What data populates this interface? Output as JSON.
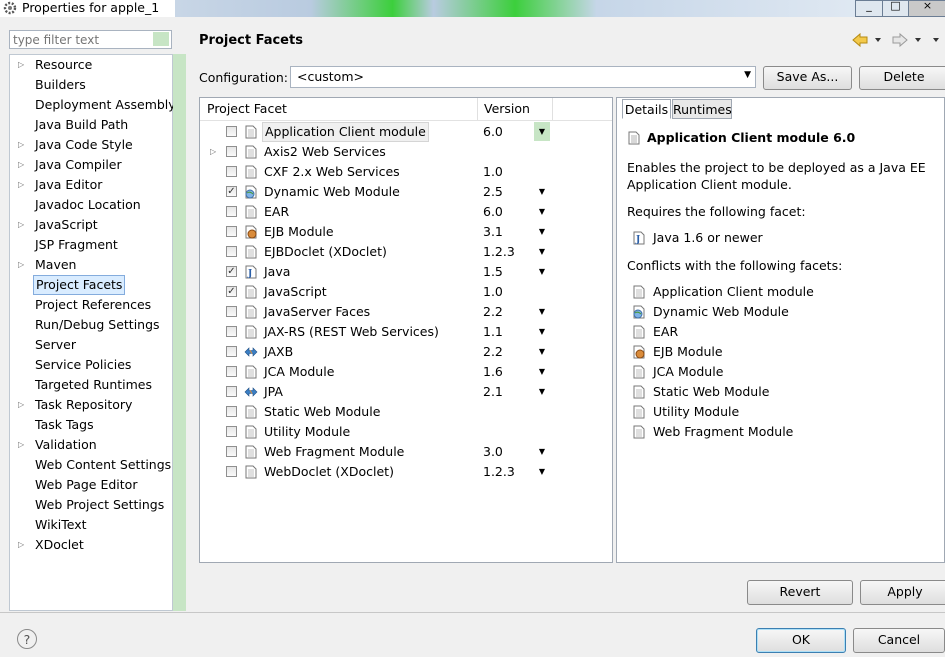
{
  "window": {
    "title": "Properties for apple_1",
    "controls": [
      "_",
      "□",
      "×"
    ]
  },
  "filter": {
    "placeholder": "type filter text"
  },
  "left_tree": [
    {
      "label": "Resource",
      "expandable": true
    },
    {
      "label": "Builders",
      "expandable": false
    },
    {
      "label": "Deployment Assembly",
      "expandable": false
    },
    {
      "label": "Java Build Path",
      "expandable": false
    },
    {
      "label": "Java Code Style",
      "expandable": true
    },
    {
      "label": "Java Compiler",
      "expandable": true
    },
    {
      "label": "Java Editor",
      "expandable": true
    },
    {
      "label": "Javadoc Location",
      "expandable": false
    },
    {
      "label": "JavaScript",
      "expandable": true
    },
    {
      "label": "JSP Fragment",
      "expandable": false
    },
    {
      "label": "Maven",
      "expandable": true
    },
    {
      "label": "Project Facets",
      "expandable": false,
      "selected": true
    },
    {
      "label": "Project References",
      "expandable": false
    },
    {
      "label": "Run/Debug Settings",
      "expandable": false
    },
    {
      "label": "Server",
      "expandable": false
    },
    {
      "label": "Service Policies",
      "expandable": false
    },
    {
      "label": "Targeted Runtimes",
      "expandable": false
    },
    {
      "label": "Task Repository",
      "expandable": true
    },
    {
      "label": "Task Tags",
      "expandable": false
    },
    {
      "label": "Validation",
      "expandable": true
    },
    {
      "label": "Web Content Settings",
      "expandable": false
    },
    {
      "label": "Web Page Editor",
      "expandable": false
    },
    {
      "label": "Web Project Settings",
      "expandable": false
    },
    {
      "label": "WikiText",
      "expandable": false
    },
    {
      "label": "XDoclet",
      "expandable": true
    }
  ],
  "page": {
    "title": "Project Facets"
  },
  "configuration": {
    "label": "Configuration:",
    "value": "<custom>",
    "save_as": "Save As...",
    "delete": "Delete"
  },
  "facets": {
    "headers": {
      "facet": "Project Facet",
      "version": "Version"
    },
    "rows": [
      {
        "name": "Application Client module",
        "version": "6.0",
        "checked": false,
        "dropdown": true,
        "icon": "page-icon",
        "selected": true
      },
      {
        "name": "Axis2 Web Services",
        "version": "",
        "checked": false,
        "dropdown": false,
        "icon": "page-icon",
        "expandable": true
      },
      {
        "name": "CXF 2.x Web Services",
        "version": "1.0",
        "checked": false,
        "dropdown": false,
        "icon": "page-icon"
      },
      {
        "name": "Dynamic Web Module",
        "version": "2.5",
        "checked": true,
        "dropdown": true,
        "icon": "globe-icon"
      },
      {
        "name": "EAR",
        "version": "6.0",
        "checked": false,
        "dropdown": true,
        "icon": "page-icon"
      },
      {
        "name": "EJB Module",
        "version": "3.1",
        "checked": false,
        "dropdown": true,
        "icon": "bean-icon"
      },
      {
        "name": "EJBDoclet (XDoclet)",
        "version": "1.2.3",
        "checked": false,
        "dropdown": true,
        "icon": "page-icon"
      },
      {
        "name": "Java",
        "version": "1.5",
        "checked": true,
        "dropdown": true,
        "icon": "java-icon"
      },
      {
        "name": "JavaScript",
        "version": "1.0",
        "checked": true,
        "dropdown": false,
        "icon": "page-icon"
      },
      {
        "name": "JavaServer Faces",
        "version": "2.2",
        "checked": false,
        "dropdown": true,
        "icon": "page-icon"
      },
      {
        "name": "JAX-RS (REST Web Services)",
        "version": "1.1",
        "checked": false,
        "dropdown": true,
        "icon": "page-icon"
      },
      {
        "name": "JAXB",
        "version": "2.2",
        "checked": false,
        "dropdown": true,
        "icon": "arrows-icon"
      },
      {
        "name": "JCA Module",
        "version": "1.6",
        "checked": false,
        "dropdown": true,
        "icon": "page-icon"
      },
      {
        "name": "JPA",
        "version": "2.1",
        "checked": false,
        "dropdown": true,
        "icon": "arrows-icon"
      },
      {
        "name": "Static Web Module",
        "version": "",
        "checked": false,
        "dropdown": false,
        "icon": "page-icon"
      },
      {
        "name": "Utility Module",
        "version": "",
        "checked": false,
        "dropdown": false,
        "icon": "page-icon"
      },
      {
        "name": "Web Fragment Module",
        "version": "3.0",
        "checked": false,
        "dropdown": true,
        "icon": "page-icon"
      },
      {
        "name": "WebDoclet (XDoclet)",
        "version": "1.2.3",
        "checked": false,
        "dropdown": true,
        "icon": "page-icon"
      }
    ]
  },
  "details": {
    "tabs": [
      "Details",
      "Runtimes"
    ],
    "title": "Application Client module 6.0",
    "description": "Enables the project to be deployed as a Java EE Application Client module.",
    "requires_label": "Requires the following facet:",
    "requires": [
      {
        "name": "Java 1.6 or newer",
        "icon": "java-icon"
      }
    ],
    "conflicts_label": "Conflicts with the following facets:",
    "conflicts": [
      {
        "name": "Application Client module",
        "icon": "page-icon"
      },
      {
        "name": "Dynamic Web Module",
        "icon": "globe-icon"
      },
      {
        "name": "EAR",
        "icon": "page-icon"
      },
      {
        "name": "EJB Module",
        "icon": "bean-icon"
      },
      {
        "name": "JCA Module",
        "icon": "page-icon"
      },
      {
        "name": "Static Web Module",
        "icon": "page-icon"
      },
      {
        "name": "Utility Module",
        "icon": "page-icon"
      },
      {
        "name": "Web Fragment Module",
        "icon": "page-icon"
      }
    ]
  },
  "buttons": {
    "revert": "Revert",
    "apply": "Apply",
    "ok": "OK",
    "cancel": "Cancel",
    "help": "?"
  }
}
